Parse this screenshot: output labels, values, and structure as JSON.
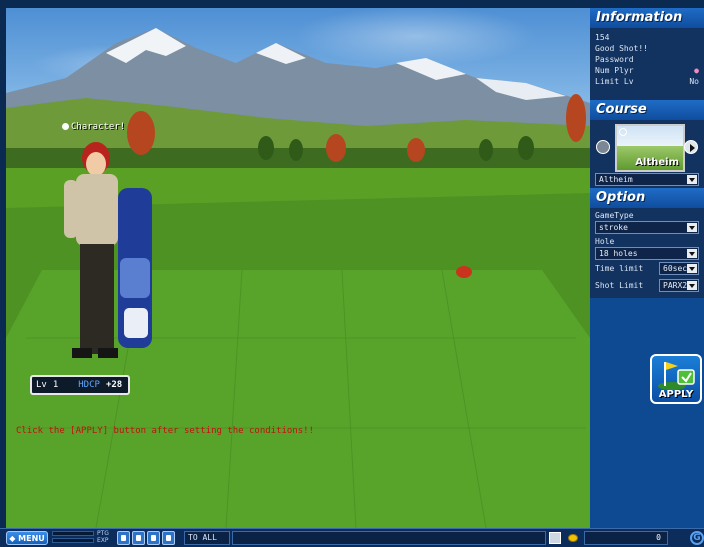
{
  "scene": {
    "character_label": "Character!",
    "level_label": "Lv",
    "level_value": "1",
    "hdcp_label": "HDCP",
    "hdcp_value": "+28",
    "hint": "Click the [APPLY] button after setting the conditions!!"
  },
  "panel": {
    "information_title": "Information",
    "info_line1": "154",
    "info_line2": "Good Shot!!",
    "password_label": "Password",
    "num_plyr_label": "Num Plyr",
    "limit_lv_label": "Limit Lv",
    "limit_lv_value": "No",
    "course_title": "Course",
    "course_thumb_name": "Altheim",
    "course_select": "Altheim",
    "option_title": "Option",
    "gametype_label": "GameType",
    "gametype_value": "stroke",
    "hole_label": "Hole",
    "hole_value": "18 holes",
    "time_limit_label": "Time limit",
    "time_limit_value": "60sec",
    "shot_limit_label": "Shot Limit",
    "shot_limit_value": "PARX2",
    "apply_label": "APPLY"
  },
  "bar": {
    "menu_label": "MENU",
    "ptg_label": "PTG",
    "exp_label": "EXP",
    "ptg_fraction": 0.0,
    "exp_fraction": 0.0,
    "chat_target": "TO ALL",
    "pang_value": "0",
    "g_label": "G"
  },
  "colors": {
    "panel_bg": "#0e4a92",
    "hint_red": "#c41010",
    "hdcp_blue": "#5fa8ff"
  }
}
